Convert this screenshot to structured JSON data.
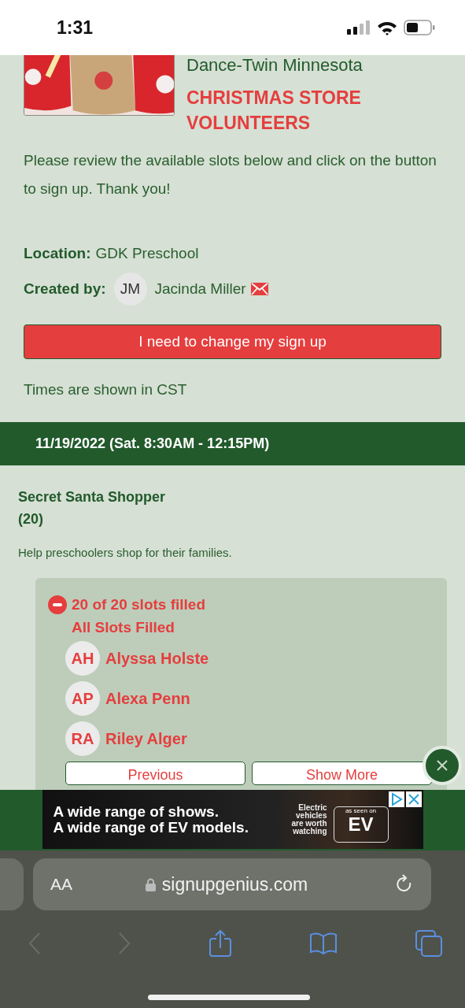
{
  "status_bar": {
    "time": "1:31"
  },
  "header": {
    "organization": "Dance-Twin Minnesota",
    "title": "CHRISTMAS STORE VOLUNTEERS"
  },
  "intro": "Please review the available slots below and click on the button to sign up. Thank you!",
  "details": [
    {
      "label": "Location:",
      "value": "GDK Preschool"
    },
    {
      "label": "Created by:",
      "initials": "JM",
      "value": "Jacinda Miller"
    }
  ],
  "change_button": "I need to change my sign up",
  "timezone_note": "Times are shown in CST",
  "date_band": "11/19/2022 (Sat. 8:30AM - 12:15PM)",
  "slot": {
    "title": "Secret Santa Shopper",
    "count": "(20)",
    "description": "Help preschoolers shop for their families.",
    "status": "20 of 20 slots filled",
    "status_note": "All Slots Filled",
    "people": [
      {
        "initials": "AH",
        "name": "Alyssa Holste"
      },
      {
        "initials": "AP",
        "name": "Alexa Penn"
      },
      {
        "initials": "RA",
        "name": "Riley Alger"
      }
    ],
    "buttons": [
      "Previous",
      "Show More"
    ]
  },
  "ad": {
    "line_1": "A wide range of shows.",
    "line_2": "A wide range of EV models.",
    "tagline": "Electric vehicles are worth watching",
    "badge_small": "as seen on",
    "badge": "EV"
  },
  "browser": {
    "text_size": "AA",
    "url": "signupgenius.com"
  }
}
